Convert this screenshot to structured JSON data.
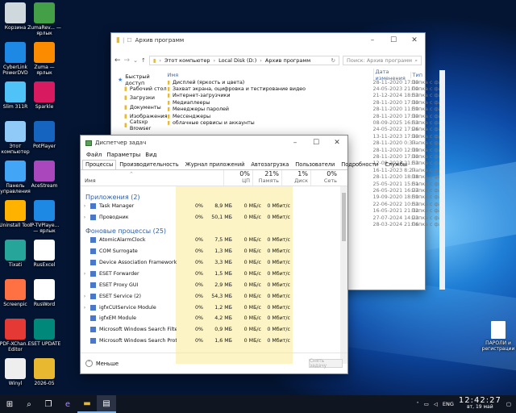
{
  "desktop": {
    "left_col": [
      {
        "label": "Корзина",
        "icon": "recycle-bin-icon"
      },
      {
        "label": "CyberLink PowerDVD",
        "icon": "powerdvd-icon"
      },
      {
        "label": "Slim 311R",
        "icon": "slim-icon"
      },
      {
        "label": "Этот компьютер",
        "icon": "computer-icon"
      },
      {
        "label": "Панель управления",
        "icon": "control-panel-icon"
      },
      {
        "label": "Uninstall Tool",
        "icon": "uninstall-icon"
      },
      {
        "label": "Tixati",
        "icon": "tixati-icon"
      },
      {
        "label": "Screenpic",
        "icon": "screenpic-icon"
      },
      {
        "label": "PDF-XChan... Editor",
        "icon": "pdf-icon"
      },
      {
        "label": "Winyl",
        "icon": "winyl-icon"
      }
    ],
    "right_col": [
      {
        "label": "ZumaRev... — ярлык",
        "icon": "zuma-icon"
      },
      {
        "label": "Zuma — ярлык",
        "icon": "zuma2-icon"
      },
      {
        "label": "Sparkle",
        "icon": "sparkle-icon"
      },
      {
        "label": "PotPlayer",
        "icon": "potplayer-icon"
      },
      {
        "label": "AceStream",
        "icon": "acestream-icon"
      },
      {
        "label": "IP-TVPlaye... — ярлык",
        "icon": "iptv-icon"
      },
      {
        "label": "RusExcel",
        "icon": "file-icon"
      },
      {
        "label": "RusWord",
        "icon": "file-icon"
      },
      {
        "label": "ESET UPDATE",
        "icon": "eset-icon"
      },
      {
        "label": "2026-05",
        "icon": "folder-icon"
      }
    ],
    "right_file": "ПАРОЛИ и регистрации"
  },
  "explorer": {
    "title": "Архив программ",
    "breadcrumb": [
      "Этот компьютер",
      "Local Disk (D:)",
      "Архив программ"
    ],
    "search_placeholder": "Поиск: Архив программ",
    "col_name": "Имя",
    "col_date": "Дата изменения",
    "col_type": "Тип",
    "nav": [
      "Быстрый доступ",
      "Рабочий стол",
      "Загрузки",
      "Документы",
      "Изображения",
      "Catsxp Browser"
    ],
    "rows": [
      {
        "name": "Дисплей (яркость и цвета)",
        "date": "28-11-2020 17:10",
        "type": "Папка с фай"
      },
      {
        "name": "Захват экрана, оцифровка и тестирование видео",
        "date": "24-05-2023 21:00",
        "type": "Папка с фай"
      },
      {
        "name": "Интернет-загрузчики",
        "date": "21-12-2024 18:53",
        "type": "Папка с фай"
      },
      {
        "name": "Медиаплееры",
        "date": "28-11-2020 17:10",
        "type": "Папка с фай"
      },
      {
        "name": "Менеджеры паролей",
        "date": "28-11-2020 11:59",
        "type": "Папка с фай"
      },
      {
        "name": "Мессенджеры",
        "date": "28-11-2020 17:10",
        "type": "Папка с фай"
      },
      {
        "name": "облачные сервисы и аккаунты",
        "date": "08-09-2025 16:53",
        "type": "Папка с фай"
      },
      {
        "name": "",
        "date": "24-05-2022 17:26",
        "type": "Папка с фай"
      },
      {
        "name": "",
        "date": "13-11-2023 17:10",
        "type": "Папка с фай"
      },
      {
        "name": "",
        "date": "28-11-2020 0:37",
        "type": "Папка с фай"
      },
      {
        "name": "",
        "date": "28-11-2020 12:19",
        "type": "Папка с фай"
      },
      {
        "name": "",
        "date": "28-11-2020 17:10",
        "type": "Папка с фай"
      },
      {
        "name": "",
        "date": "12-09-2023 21:53",
        "type": "Папка с фай"
      },
      {
        "name": "",
        "date": "16-11-2023 8:27",
        "type": "Папка с фай"
      },
      {
        "name": "",
        "date": "28-11-2020 18:18",
        "type": "Папка с фай"
      },
      {
        "name": "",
        "date": "25-05-2021 15:51",
        "type": "Папка с фай"
      },
      {
        "name": "",
        "date": "26-05-2021 16:27",
        "type": "Папка с фай"
      },
      {
        "name": "",
        "date": "19-09-2020 18:59",
        "type": "Папка с фай"
      },
      {
        "name": "",
        "date": "22-06-2022 10:53",
        "type": "Папка с фай"
      },
      {
        "name": "",
        "date": "16-05-2021 21:12",
        "type": "Папка с фай"
      },
      {
        "name": "",
        "date": "27-07-2024 14:23",
        "type": "Папка с фай"
      },
      {
        "name": "",
        "date": "28-03-2024 21:06",
        "type": "Папка с фай"
      }
    ]
  },
  "taskmgr": {
    "title": "Диспетчер задач",
    "menu": [
      "Файл",
      "Параметры",
      "Вид"
    ],
    "tabs": [
      "Процессы",
      "Производительность",
      "Журнал приложений",
      "Автозагрузка",
      "Пользователи",
      "Подробности",
      "Службы"
    ],
    "col_name": "Имя",
    "cols": [
      {
        "pct": "0%",
        "label": "ЦП"
      },
      {
        "pct": "21%",
        "label": "Память"
      },
      {
        "pct": "1%",
        "label": "Диск"
      },
      {
        "pct": "0%",
        "label": "Сеть"
      }
    ],
    "group_apps": "Приложения (2)",
    "apps": [
      {
        "name": "Task Manager",
        "cpu": "0%",
        "mem": "8,9 МБ",
        "disk": "0 МБ/с",
        "net": "0 Мбит/с",
        "expand": true
      },
      {
        "name": "Проводник",
        "cpu": "0%",
        "mem": "50,1 МБ",
        "disk": "0 МБ/с",
        "net": "0 Мбит/с",
        "expand": true
      }
    ],
    "group_bg": "Фоновые процессы (25)",
    "bg": [
      {
        "name": "AtomicAlarmClock",
        "cpu": "0%",
        "mem": "7,5 МБ",
        "disk": "0 МБ/с",
        "net": "0 Мбит/с",
        "expand": false
      },
      {
        "name": "COM Surrogate",
        "cpu": "0%",
        "mem": "1,3 МБ",
        "disk": "0 МБ/с",
        "net": "0 Мбит/с",
        "expand": false
      },
      {
        "name": "Device Association Framework ...",
        "cpu": "0%",
        "mem": "3,3 МБ",
        "disk": "0 МБ/с",
        "net": "0 Мбит/с",
        "expand": false
      },
      {
        "name": "ESET Forwarder",
        "cpu": "0%",
        "mem": "1,5 МБ",
        "disk": "0 МБ/с",
        "net": "0 Мбит/с",
        "expand": true
      },
      {
        "name": "ESET Proxy GUI",
        "cpu": "0%",
        "mem": "2,9 МБ",
        "disk": "0 МБ/с",
        "net": "0 Мбит/с",
        "expand": false
      },
      {
        "name": "ESET Service (2)",
        "cpu": "0%",
        "mem": "54,3 МБ",
        "disk": "0 МБ/с",
        "net": "0 Мбит/с",
        "expand": true
      },
      {
        "name": "igfxCUIService Module",
        "cpu": "0%",
        "mem": "1,2 МБ",
        "disk": "0 МБ/с",
        "net": "0 Мбит/с",
        "expand": true
      },
      {
        "name": "igfxEM Module",
        "cpu": "0%",
        "mem": "4,2 МБ",
        "disk": "0 МБ/с",
        "net": "0 Мбит/с",
        "expand": false
      },
      {
        "name": "Microsoft Windows Search Filte...",
        "cpu": "0%",
        "mem": "0,9 МБ",
        "disk": "0 МБ/с",
        "net": "0 Мбит/с",
        "expand": false
      },
      {
        "name": "Microsoft Windows Search Prot...",
        "cpu": "0%",
        "mem": "1,6 МБ",
        "disk": "0 МБ/с",
        "net": "0 Мбит/с",
        "expand": false
      }
    ],
    "less_label": "Меньше",
    "end_task_label": "Снять задачу"
  },
  "taskbar": {
    "lang": "ENG",
    "time": "12:42:27",
    "date": "вт, 19 май"
  },
  "colors": {
    "accent": "#0063b1",
    "heat": "#fdf4c5",
    "link": "#2e5fa8"
  }
}
